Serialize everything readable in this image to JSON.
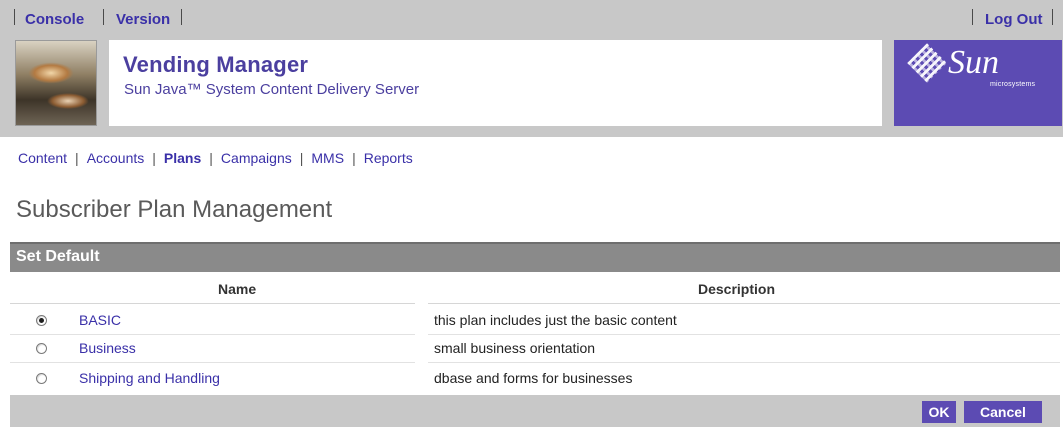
{
  "header": {
    "links_left": [
      "Console",
      "Version"
    ],
    "link_right": "Log Out",
    "app_title": "Vending Manager",
    "app_subtitle": "Sun Java™ System Content Delivery Server",
    "logo_text": "Sun",
    "logo_sub": "microsystems"
  },
  "nav": {
    "items": [
      "Content",
      "Accounts",
      "Plans",
      "Campaigns",
      "MMS",
      "Reports"
    ],
    "active": "Plans",
    "separator": "|"
  },
  "page_title": "Subscriber Plan Management",
  "table": {
    "title": "Set Default",
    "columns": [
      "Name",
      "Description"
    ],
    "rows": [
      {
        "name": "BASIC",
        "description": "this plan includes just the basic content",
        "selected": true
      },
      {
        "name": "Business",
        "description": "small business orientation",
        "selected": false
      },
      {
        "name": "Shipping and Handling",
        "description": "dbase and forms for businesses",
        "selected": false
      }
    ]
  },
  "buttons": {
    "ok": "OK",
    "cancel": "Cancel"
  },
  "colors": {
    "accent": "#5c4bb3",
    "link": "#3a30a8",
    "header_gray": "#c8c8c8",
    "table_head": "#8a8a8a"
  }
}
